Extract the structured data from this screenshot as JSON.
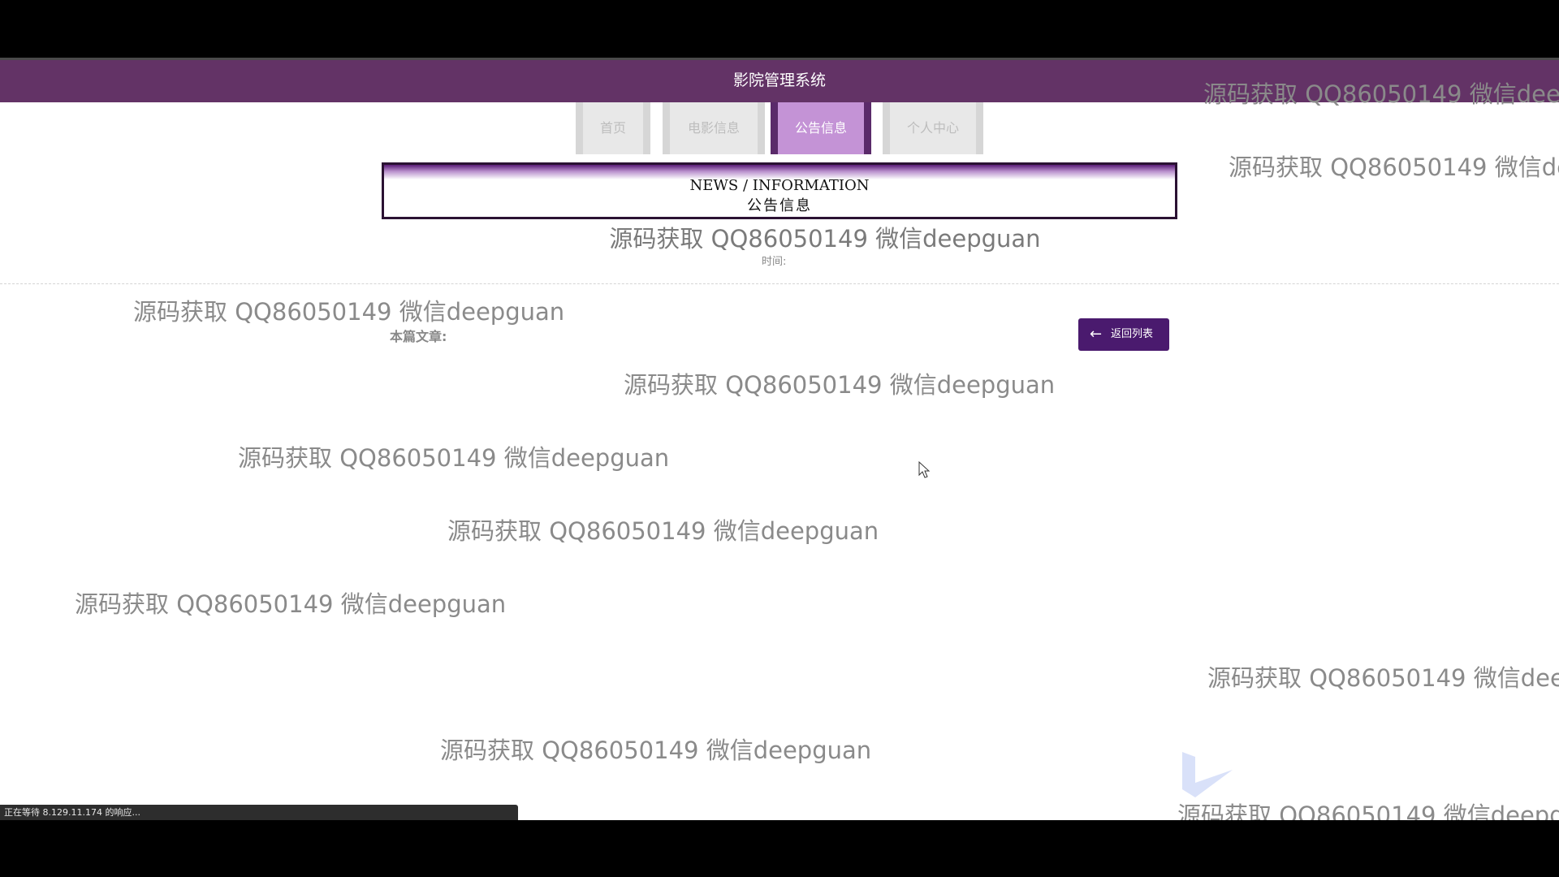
{
  "header": {
    "title": "影院管理系统"
  },
  "nav": {
    "tabs": [
      {
        "label": "首页",
        "active": false
      },
      {
        "label": "电影信息",
        "active": false
      },
      {
        "label": "公告信息",
        "active": true
      },
      {
        "label": "个人中心",
        "active": false
      }
    ]
  },
  "section": {
    "title_en": "NEWS / INFORMATION",
    "title_cn": "公告信息"
  },
  "article": {
    "title": "源码获取 QQ86050149 微信deepguan",
    "time_label": "时间:",
    "this_article_label": "本篇文章:"
  },
  "actions": {
    "back_label": "返回列表",
    "back_icon": "arrow-left-icon"
  },
  "watermark": {
    "text": "源码获取 QQ86050149 微信deepguan"
  },
  "statusbar": {
    "text": "正在等待 8.129.11.174 的响应..."
  },
  "colors": {
    "header_bg": "#633366",
    "active_tab": "#c493d6",
    "button_bg": "#4a1a6e"
  }
}
